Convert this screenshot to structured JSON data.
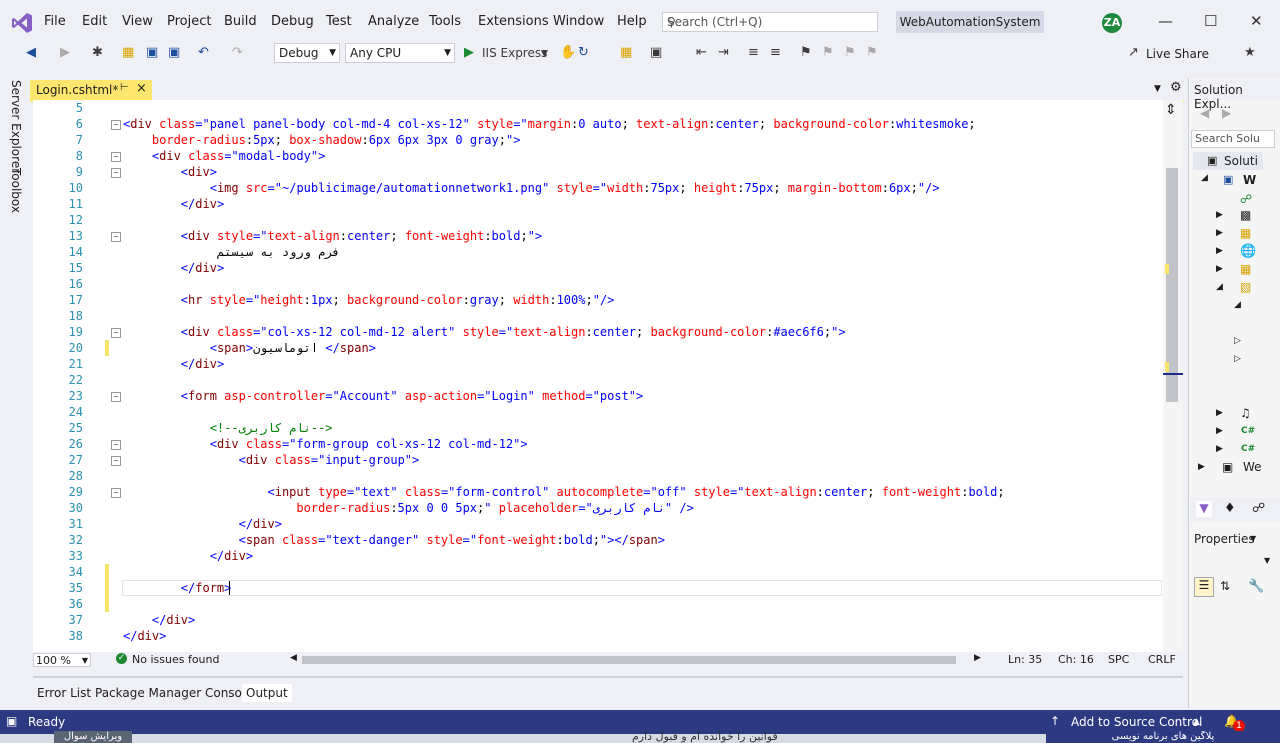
{
  "menu": [
    "File",
    "Edit",
    "View",
    "Project",
    "Build",
    "Debug",
    "Test",
    "Analyze",
    "Tools",
    "Extensions",
    "Window",
    "Help"
  ],
  "search": {
    "placeholder": "Search (Ctrl+Q)"
  },
  "solution_name": "WebAutomationSystem",
  "user_initials": "ZA",
  "toolbar": {
    "config": "Debug",
    "platform": "Any CPU",
    "run_target": "IIS Express",
    "live_share": "Live Share"
  },
  "left_rail": [
    "Server Explorer",
    "Toolbox"
  ],
  "doc_tab": {
    "label": "Login.cshtml*"
  },
  "code_lines": [
    {
      "n": "5",
      "html": ""
    },
    {
      "n": "6",
      "fold": "-",
      "html": "<span class='v'>&lt;</span><span class='t'>div</span> <span class='a'>class</span><span class='v'>=\"panel panel-body col-md-4 col-xs-12\"</span> <span class='a'>style</span><span class='v'>=\"</span><span class='a'>margin</span><span class='d'>:</span><span class='v'>0 auto</span><span class='d'>; </span><span class='a'>text-align</span><span class='d'>:</span><span class='v'>center</span><span class='d'>; </span><span class='a'>background-color</span><span class='d'>:</span><span class='v'>whitesmoke</span><span class='d'>;</span>"
    },
    {
      "n": "7",
      "html": "    <span class='a'>border-radius</span><span class='d'>:</span><span class='v'>5px</span><span class='d'>; </span><span class='a'>box-shadow</span><span class='d'>:</span><span class='v'>6px 6px 3px 0 gray</span><span class='d'>;</span><span class='v'>\"&gt;</span>"
    },
    {
      "n": "8",
      "fold": "-",
      "html": "    <span class='v'>&lt;</span><span class='t'>div</span> <span class='a'>class</span><span class='v'>=\"modal-body\"&gt;</span>"
    },
    {
      "n": "9",
      "fold": "-",
      "html": "        <span class='v'>&lt;</span><span class='t'>div</span><span class='v'>&gt;</span>"
    },
    {
      "n": "10",
      "html": "            <span class='v'>&lt;</span><span class='t'>img</span> <span class='a'>src</span><span class='v'>=\"~/publicimage/automationnetwork1.png\"</span> <span class='a'>style</span><span class='v'>=\"</span><span class='a'>width</span><span class='d'>:</span><span class='v'>75px</span><span class='d'>; </span><span class='a'>height</span><span class='d'>:</span><span class='v'>75px</span><span class='d'>; </span><span class='a'>margin-bottom</span><span class='d'>:</span><span class='v'>6px</span><span class='d'>;</span><span class='v'>\"/&gt;</span>"
    },
    {
      "n": "11",
      "html": "        <span class='v'>&lt;/</span><span class='t'>div</span><span class='v'>&gt;</span>"
    },
    {
      "n": "12",
      "html": ""
    },
    {
      "n": "13",
      "fold": "-",
      "html": "        <span class='v'>&lt;</span><span class='t'>div</span> <span class='a'>style</span><span class='v'>=\"</span><span class='a'>text-align</span><span class='d'>:</span><span class='v'>center</span><span class='d'>; </span><span class='a'>font-weight</span><span class='d'>:</span><span class='v'>bold</span><span class='d'>;</span><span class='v'>\"&gt;</span>"
    },
    {
      "n": "14",
      "html": "             <span class='d'>فرم ورود به سیستم</span>"
    },
    {
      "n": "15",
      "html": "        <span class='v'>&lt;/</span><span class='t'>div</span><span class='v'>&gt;</span>"
    },
    {
      "n": "16",
      "html": ""
    },
    {
      "n": "17",
      "html": "        <span class='v'>&lt;</span><span class='t'>hr</span> <span class='a'>style</span><span class='v'>=\"</span><span class='a'>height</span><span class='d'>:</span><span class='v'>1px</span><span class='d'>; </span><span class='a'>background-color</span><span class='d'>:</span><span class='v'>gray</span><span class='d'>; </span><span class='a'>width</span><span class='d'>:</span><span class='v'>100%</span><span class='d'>;</span><span class='v'>\"/&gt;</span>"
    },
    {
      "n": "18",
      "html": ""
    },
    {
      "n": "19",
      "fold": "-",
      "html": "        <span class='v'>&lt;</span><span class='t'>div</span> <span class='a'>class</span><span class='v'>=\"col-xs-12 col-md-12 alert\"</span> <span class='a'>style</span><span class='v'>=\"</span><span class='a'>text-align</span><span class='d'>:</span><span class='v'>center</span><span class='d'>; </span><span class='a'>background-color</span><span class='d'>:</span><span class='v'>#aec6f6</span><span class='d'>;</span><span class='v'>\"&gt;</span>"
    },
    {
      "n": "20",
      "bar": true,
      "html": "            <span class='v'>&lt;</span><span class='t'>span</span><span class='v'>&gt;</span><span class='d'>اتوماسیون </span><span class='v'>&lt;/</span><span class='t'>span</span><span class='v'>&gt;</span>"
    },
    {
      "n": "21",
      "html": "        <span class='v'>&lt;/</span><span class='t'>div</span><span class='v'>&gt;</span>"
    },
    {
      "n": "22",
      "html": ""
    },
    {
      "n": "23",
      "fold": "-",
      "html": "        <span class='v'>&lt;</span><span class='t'>form</span> <span class='a'>asp-controller</span><span class='v'>=\"Account\"</span> <span class='a'>asp-action</span><span class='v'>=\"Login\"</span> <span class='a'>method</span><span class='v'>=\"post\"&gt;</span>"
    },
    {
      "n": "24",
      "html": ""
    },
    {
      "n": "25",
      "html": "            <span class='cm'>&lt;!--نام کاربری--&gt;</span>"
    },
    {
      "n": "26",
      "fold": "-",
      "html": "            <span class='v'>&lt;</span><span class='t'>div</span> <span class='a'>class</span><span class='v'>=\"form-group col-xs-12 col-md-12\"&gt;</span>"
    },
    {
      "n": "27",
      "fold": "-",
      "html": "                <span class='v'>&lt;</span><span class='t'>div</span> <span class='a'>class</span><span class='v'>=\"input-group\"&gt;</span>"
    },
    {
      "n": "28",
      "html": ""
    },
    {
      "n": "29",
      "fold": "-",
      "html": "                    <span class='v'>&lt;</span><span class='t'>input</span> <span class='a'>type</span><span class='v'>=\"text\"</span> <span class='a'>class</span><span class='v'>=\"form-control\"</span> <span class='a'>autocomplete</span><span class='v'>=\"off\"</span> <span class='a'>style</span><span class='v'>=\"</span><span class='a'>text-align</span><span class='d'>:</span><span class='v'>center</span><span class='d'>; </span><span class='a'>font-weight</span><span class='d'>:</span><span class='v'>bold</span><span class='d'>;</span>"
    },
    {
      "n": "30",
      "html": "                        <span class='a'>border-radius</span><span class='d'>:</span><span class='v'>5px 0 0 5px</span><span class='d'>;</span><span class='v'>\"</span> <span class='a'>placeholder</span><span class='v'>=\"نام کاربری\"</span> <span class='v'>/&gt;</span>"
    },
    {
      "n": "31",
      "html": "                <span class='v'>&lt;/</span><span class='t'>div</span><span class='v'>&gt;</span>"
    },
    {
      "n": "32",
      "html": "                <span class='v'>&lt;</span><span class='t'>span</span> <span class='a'>class</span><span class='v'>=\"text-danger\"</span> <span class='a'>style</span><span class='v'>=\"</span><span class='a'>font-weight</span><span class='d'>:</span><span class='v'>bold</span><span class='d'>;</span><span class='v'>\"&gt;&lt;/</span><span class='t'>span</span><span class='v'>&gt;</span>"
    },
    {
      "n": "33",
      "html": "            <span class='v'>&lt;/</span><span class='t'>div</span><span class='v'>&gt;</span>"
    },
    {
      "n": "34",
      "bar": true,
      "html": ""
    },
    {
      "n": "35",
      "bar": true,
      "html": "        <span class='v'>&lt;/</span><span class='t'>form</span><span class='v'>&gt;</span>"
    },
    {
      "n": "36",
      "bar": true,
      "html": ""
    },
    {
      "n": "37",
      "html": "    <span class='v'>&lt;/</span><span class='t'>div</span><span class='v'>&gt;</span>"
    },
    {
      "n": "38",
      "html": "<span class='v'>&lt;/</span><span class='t'>div</span><span class='v'>&gt;</span>"
    }
  ],
  "editor_status": {
    "zoom": "100 %",
    "issues": "No issues found",
    "ln": "Ln: 35",
    "ch": "Ch: 16",
    "spc": "SPC",
    "crlf": "CRLF"
  },
  "bottom_tabs": [
    "Error List",
    "Package Manager Console",
    "Output"
  ],
  "solution_panel": {
    "title": "Solution Expl...",
    "search": "Search Solu",
    "root": "Soluti",
    "project": "W",
    "item_cs": "C#",
    "item_w": "We"
  },
  "properties_panel": {
    "title": "Properties"
  },
  "statusbar": {
    "ready": "Ready",
    "source_control": "Add to Source Control",
    "notifications": "1"
  },
  "taskbar_snippets": [
    "ویرایش سوال",
    "قوانین را خوانده ام و قبول دارم",
    "پلاگین های برنامه نویسی"
  ],
  "colors": {
    "accent": "#2d3a82",
    "tab": "#fce66e",
    "avatar": "#1f8a3e"
  }
}
